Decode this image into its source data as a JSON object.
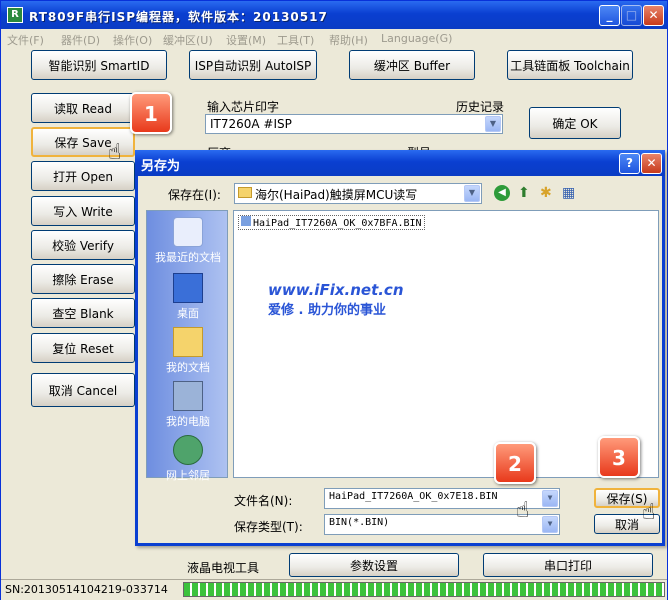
{
  "window": {
    "title": "RT809F串行ISP编程器，软件版本：20130517",
    "min": "_",
    "max": "□",
    "close": "✕"
  },
  "menu": [
    "文件(F)",
    "器件(D)",
    "操作(O)",
    "缓冲区(U)",
    "设置(M)",
    "工具(T)",
    "帮助(H)",
    "Language(G)"
  ],
  "topButtons": [
    "智能识别 SmartID",
    "ISP自动识别 AutoISP",
    "缓冲区 Buffer",
    "工具链面板 Toolchain"
  ],
  "leftButtons": [
    "读取 Read",
    "保存 Save",
    "打开 Open",
    "写入 Write",
    "校验 Verify",
    "擦除 Erase",
    "查空 Blank",
    "复位 Reset",
    "取消 Cancel"
  ],
  "chip": {
    "label": "输入芯片印字",
    "history": "历史记录",
    "value": "IT7260A #ISP",
    "confirm": "确定 OK",
    "factory": "厂商",
    "count": "型号"
  },
  "dialog": {
    "title": "另存为",
    "help": "?",
    "close": "✕",
    "saveInLabel": "保存在(I):",
    "folder": "海尔(HaiPad)触摸屏MCU读写",
    "places": [
      "我最近的文档",
      "桌面",
      "我的文档",
      "我的电脑",
      "网上邻居"
    ],
    "file": "HaiPad_IT7260A_OK_0x7BFA.BIN",
    "filenameLabel": "文件名(N):",
    "filenameValue": "HaiPad_IT7260A_OK_0x7E18.BIN",
    "typeLabel": "保存类型(T):",
    "typeValue": "BIN(*.BIN)",
    "save": "保存(S)",
    "cancel": "取消"
  },
  "watermark": {
    "url": "www.iFix.net.cn",
    "slogan": "爱修 . 助力你的事业"
  },
  "bottom": {
    "lcd": "液晶电视工具",
    "params": "参数设置",
    "print": "串口打印"
  },
  "statusbar": {
    "sn": "SN:20130514104219-033714",
    "progress": 1.0
  },
  "callouts": [
    "1",
    "2",
    "3"
  ]
}
